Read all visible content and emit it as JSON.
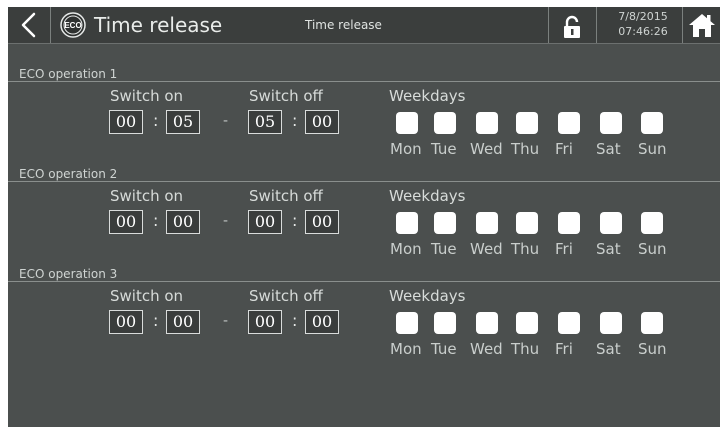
{
  "header": {
    "title": "Time release",
    "subtitle": "Time release",
    "date": "7/8/2015",
    "time": "07:46:26",
    "logo_text": "ECO"
  },
  "labels": {
    "switch_on": "Switch on",
    "switch_off": "Switch off",
    "weekdays": "Weekdays",
    "colon": ":",
    "dash": "-"
  },
  "days": [
    "Mon",
    "Tue",
    "Wed",
    "Thu",
    "Fri",
    "Sat",
    "Sun"
  ],
  "operations": [
    {
      "label": "ECO operation 1",
      "on_h": "00",
      "on_m": "05",
      "off_h": "05",
      "off_m": "00",
      "checked": [
        false,
        false,
        false,
        false,
        false,
        false,
        false
      ]
    },
    {
      "label": "ECO operation 2",
      "on_h": "00",
      "on_m": "00",
      "off_h": "00",
      "off_m": "00",
      "checked": [
        false,
        false,
        false,
        false,
        false,
        false,
        false
      ]
    },
    {
      "label": "ECO operation 3",
      "on_h": "00",
      "on_m": "00",
      "off_h": "00",
      "off_m": "00",
      "checked": [
        false,
        false,
        false,
        false,
        false,
        false,
        false
      ]
    }
  ],
  "colors": {
    "background": "#4b4f4e",
    "header": "#3b3e3d",
    "text": "#d7dbd9",
    "checkbox": "#ffffff"
  },
  "icons": [
    "back-arrow-icon",
    "eco-logo-icon",
    "unlock-icon",
    "home-icon"
  ]
}
